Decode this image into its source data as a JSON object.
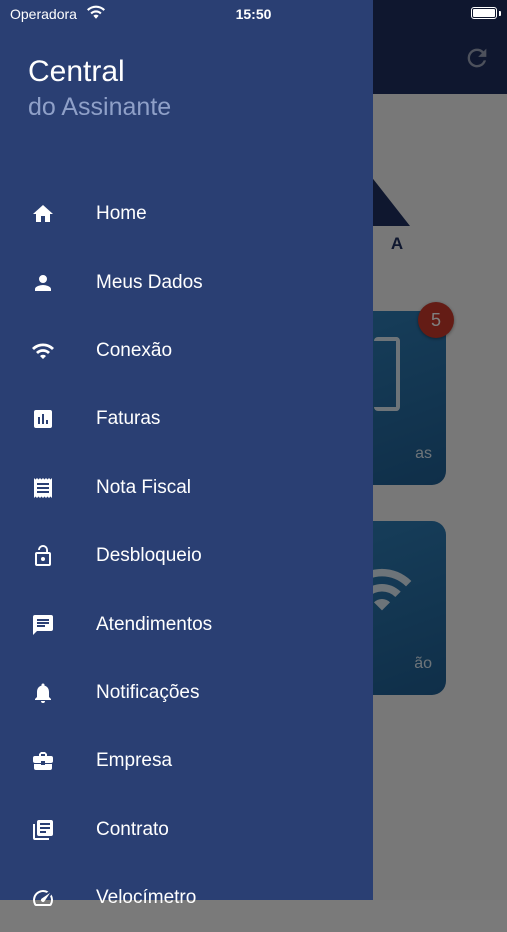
{
  "status_bar": {
    "carrier": "Operadora",
    "time": "15:50"
  },
  "drawer": {
    "title": "Central",
    "subtitle": "do Assinante",
    "menu": [
      {
        "label": "Home",
        "icon": "home-icon"
      },
      {
        "label": "Meus Dados",
        "icon": "person-icon"
      },
      {
        "label": "Conexão",
        "icon": "wifi-icon"
      },
      {
        "label": "Faturas",
        "icon": "bar-chart-icon"
      },
      {
        "label": "Nota Fiscal",
        "icon": "receipt-icon"
      },
      {
        "label": "Desbloqueio",
        "icon": "unlock-icon"
      },
      {
        "label": "Atendimentos",
        "icon": "chat-icon"
      },
      {
        "label": "Notificações",
        "icon": "bell-icon"
      },
      {
        "label": "Empresa",
        "icon": "briefcase-icon"
      },
      {
        "label": "Contrato",
        "icon": "library-books-icon"
      },
      {
        "label": "Velocímetro",
        "icon": "speedometer-icon"
      }
    ]
  },
  "background": {
    "logo_letters": "A",
    "logo_letters_partial": "I A",
    "cards": [
      {
        "label_fragment": "as",
        "badge": "5"
      },
      {
        "label_fragment": "ão"
      }
    ]
  },
  "colors": {
    "drawer_bg": "#2a3f73",
    "header_bg": "#1e2f5e",
    "card_bg": "#2f7fb8",
    "badge_bg": "#c8392b"
  }
}
